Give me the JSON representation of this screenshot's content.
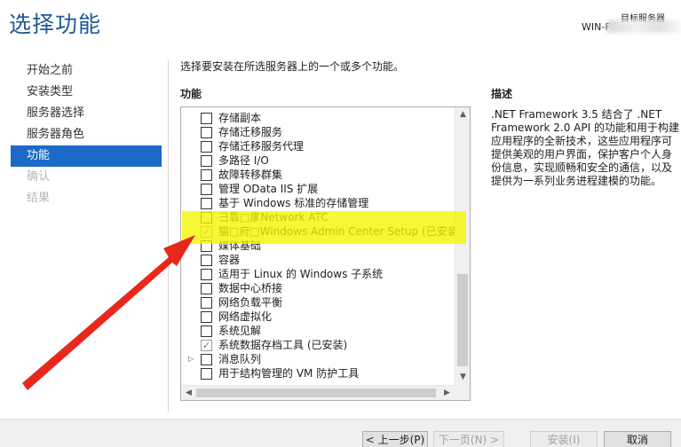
{
  "window": {
    "title": "选择功能",
    "destination_label": "目标服务器",
    "destination_server": "WIN-F"
  },
  "nav": {
    "items": [
      {
        "label": "开始之前",
        "state": "normal"
      },
      {
        "label": "安装类型",
        "state": "normal"
      },
      {
        "label": "服务器选择",
        "state": "normal"
      },
      {
        "label": "服务器角色",
        "state": "normal"
      },
      {
        "label": "功能",
        "state": "active"
      },
      {
        "label": "确认",
        "state": "disabled"
      },
      {
        "label": "结果",
        "state": "disabled"
      }
    ]
  },
  "main": {
    "intro": "选择要安装在所选服务器上的一个或多个功能。",
    "features_header": "功能",
    "description_header": "描述",
    "description": ".NET Framework 3.5 结合了 .NET Framework 2.0 API 的功能和用于构建应用程序的全新技术，这些应用程序可提供美观的用户界面，保护客户个人身份信息，实现顺畅和安全的通信，以及提供为一系列业务进程建模的功能。",
    "features": [
      {
        "label": "存储副本",
        "checked": false,
        "expandable": false
      },
      {
        "label": "存储迁移服务",
        "checked": false,
        "expandable": false
      },
      {
        "label": "存储迁移服务代理",
        "checked": false,
        "expandable": false
      },
      {
        "label": "多路径 I/O",
        "checked": false,
        "expandable": false
      },
      {
        "label": "故障转移群集",
        "checked": false,
        "expandable": false
      },
      {
        "label": "管理 OData IIS 扩展",
        "checked": false,
        "expandable": false
      },
      {
        "label": "基于 Windows 标准的存储管理",
        "checked": false,
        "expandable": false
      },
      {
        "label": "彐靠□扅Network ATC",
        "checked": false,
        "expandable": false
      },
      {
        "label": "猫□府□Windows Admin Center Setup (已安装)",
        "checked": true,
        "expandable": false
      },
      {
        "label": "媒体基础",
        "checked": false,
        "expandable": false
      },
      {
        "label": "容器",
        "checked": false,
        "expandable": false
      },
      {
        "label": "适用于 Linux 的 Windows 子系统",
        "checked": false,
        "expandable": false
      },
      {
        "label": "数据中心桥接",
        "checked": false,
        "expandable": false
      },
      {
        "label": "网络负载平衡",
        "checked": false,
        "expandable": false
      },
      {
        "label": "网络虚拟化",
        "checked": false,
        "expandable": false
      },
      {
        "label": "系统见解",
        "checked": false,
        "expandable": false
      },
      {
        "label": "系统数据存档工具 (已安装)",
        "checked": true,
        "expandable": false
      },
      {
        "label": "消息队列",
        "checked": false,
        "expandable": true
      },
      {
        "label": "用于结构管理的 VM 防护工具",
        "checked": false,
        "expandable": false
      }
    ]
  },
  "buttons": {
    "prev": "< 上一步(P)",
    "next": "下一页(N) >",
    "install": "安装(I)",
    "cancel": "取消"
  },
  "colors": {
    "title": "#1e5a96",
    "nav_active": "#1b6ac9",
    "highlight": "#f5f500",
    "annotation_arrow": "#e8281c"
  }
}
